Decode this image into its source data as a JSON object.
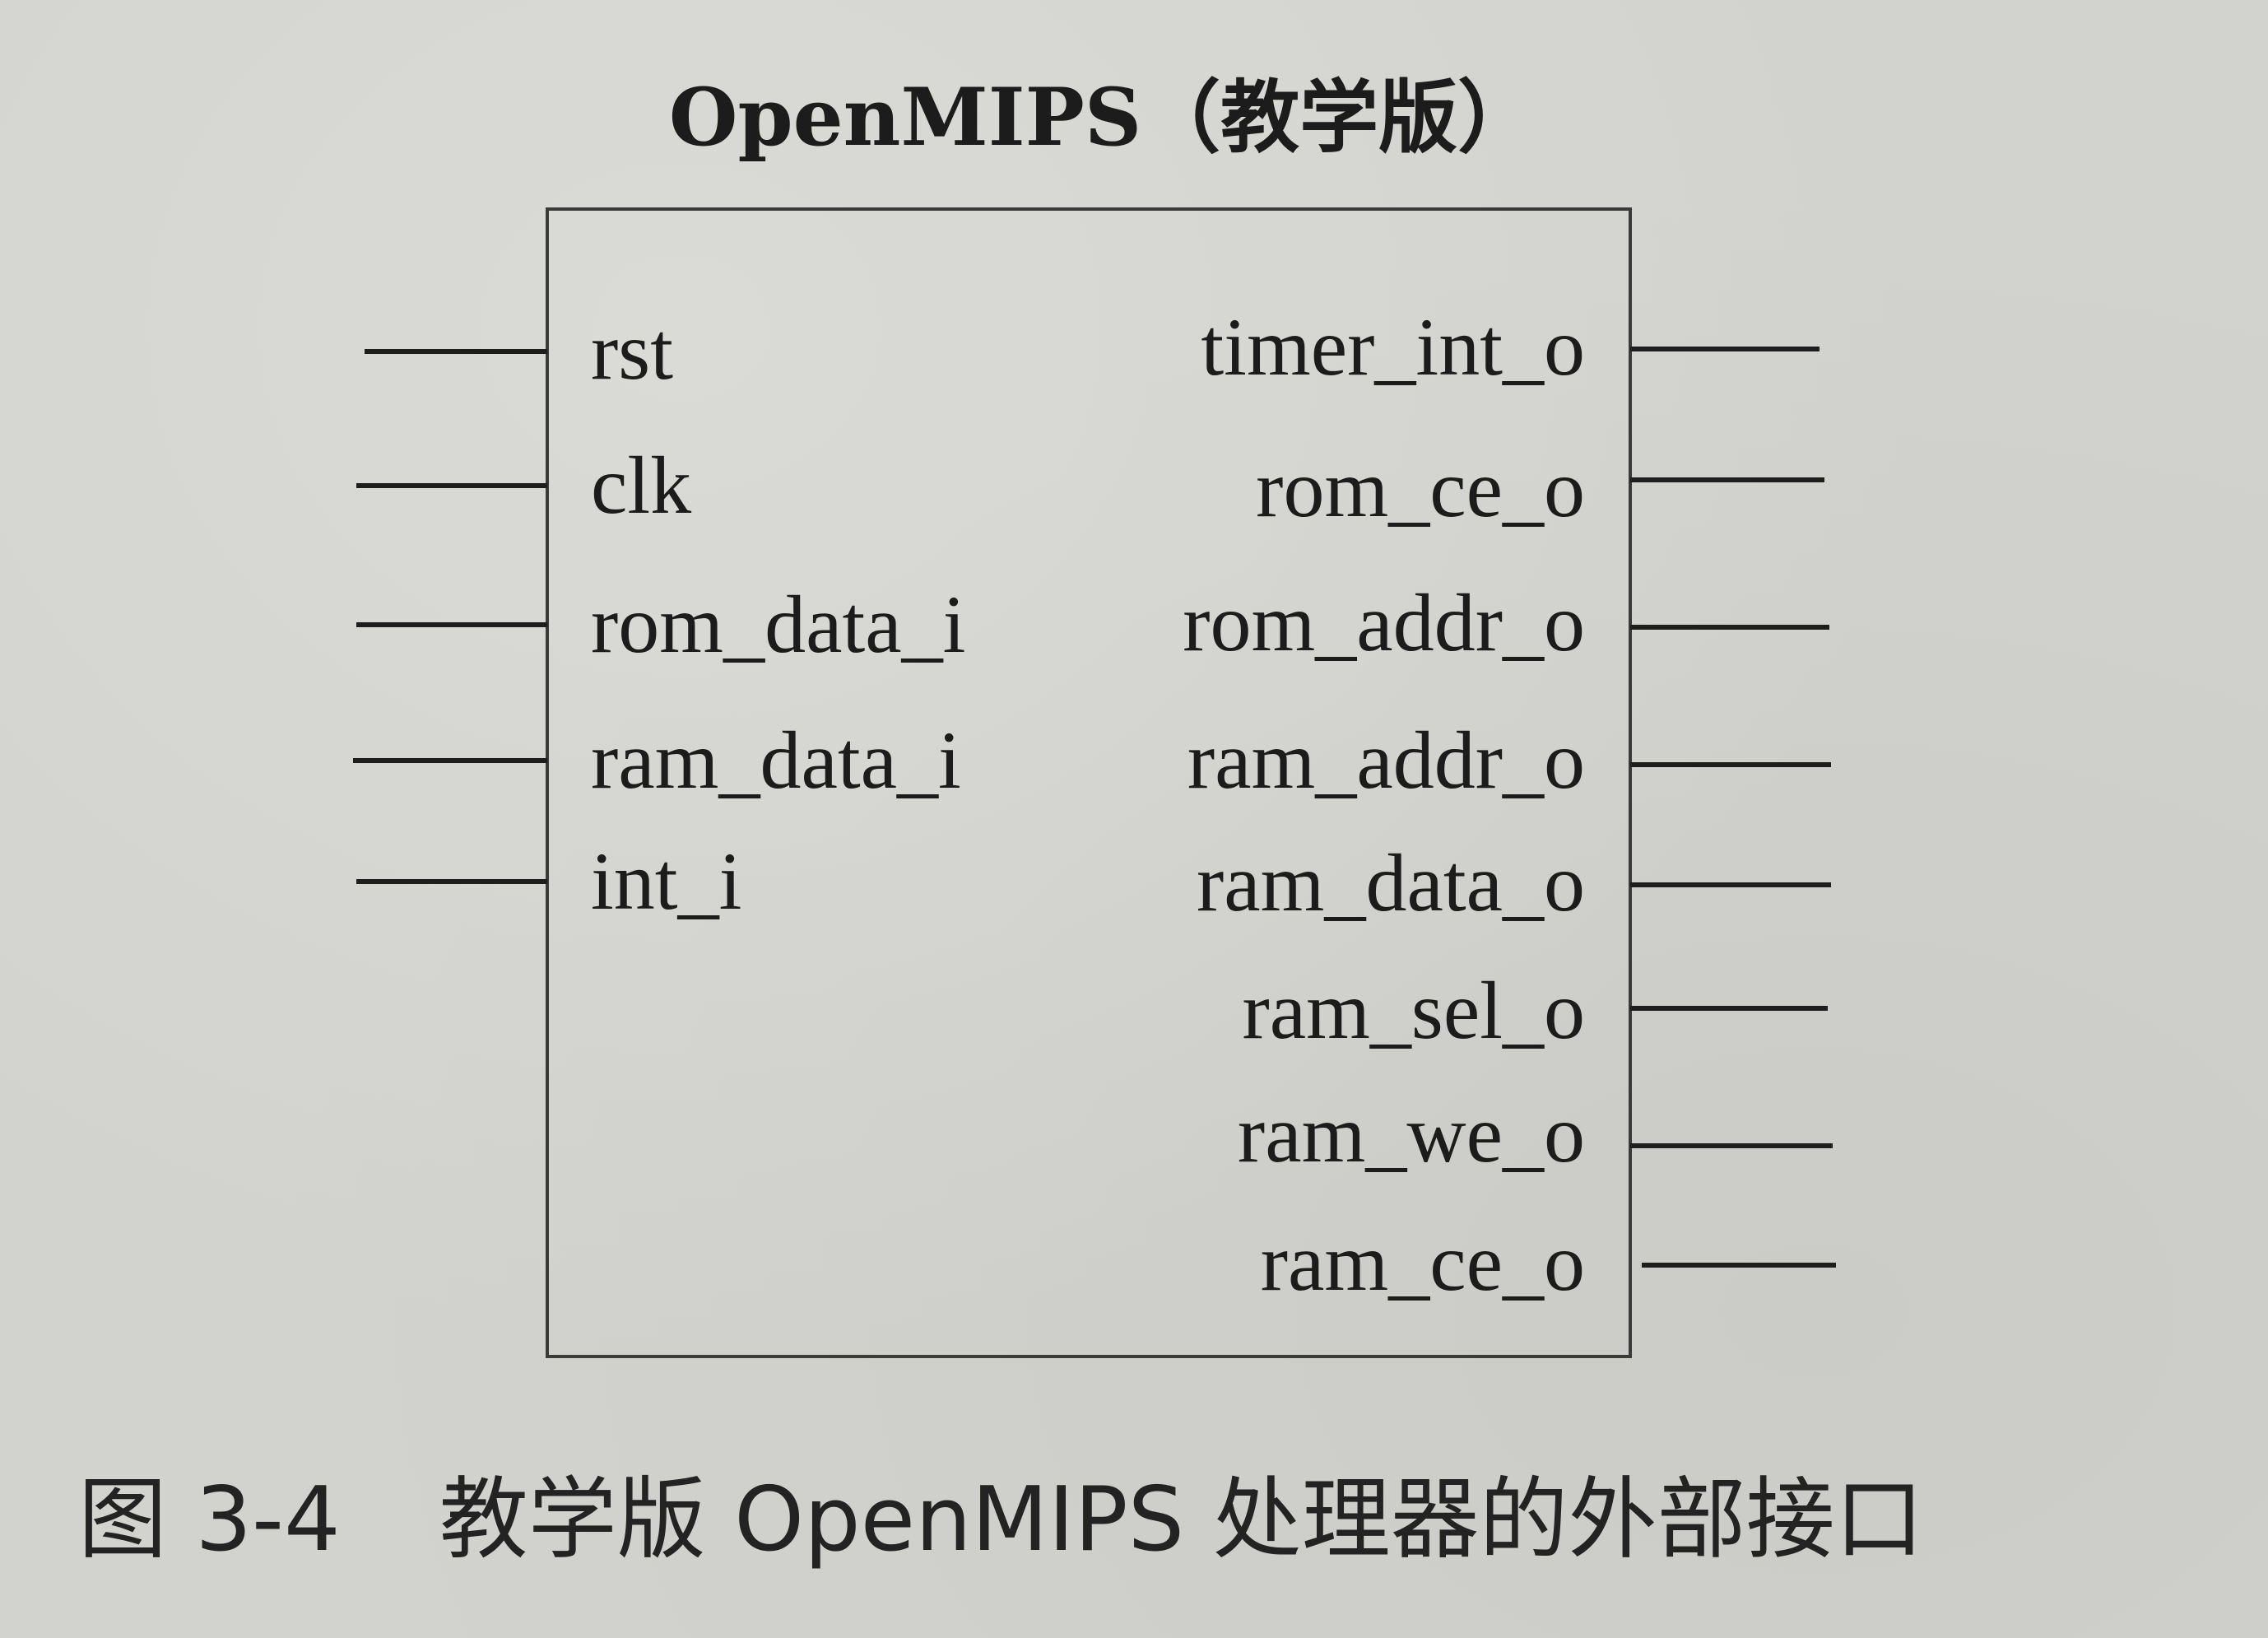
{
  "diagram": {
    "title": "OpenMIPS（教学版）",
    "inputs": [
      "rst",
      "clk",
      "rom_data_i",
      "ram_data_i",
      "int_i"
    ],
    "outputs": [
      "timer_int_o",
      "rom_ce_o",
      "rom_addr_o",
      "ram_addr_o",
      "ram_data_o",
      "ram_sel_o",
      "ram_we_o",
      "ram_ce_o"
    ]
  },
  "caption": {
    "figure_number": "图 3-4",
    "text": "教学版 OpenMIPS 处理器的外部接口"
  }
}
